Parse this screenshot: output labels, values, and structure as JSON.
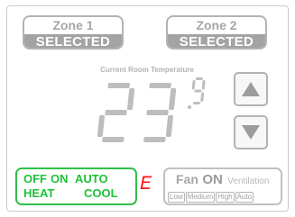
{
  "zones": [
    {
      "label": "Zone 1",
      "status": "SELECTED"
    },
    {
      "label": "Zone 2",
      "status": "SELECTED"
    }
  ],
  "temperature": {
    "label": "Current Room Temperature",
    "integer": "23",
    "decimal": "9",
    "display_color": "#bdbdbd"
  },
  "controls": {
    "up_icon": "triangle-up-icon",
    "down_icon": "triangle-down-icon"
  },
  "mode": {
    "off": "OFF",
    "on": "ON",
    "auto": "AUTO",
    "heat": "HEAT",
    "cool": "COOL",
    "accent_color": "#1ec239"
  },
  "error_indicator": {
    "text": "E",
    "color": "#ff1a1a"
  },
  "fan": {
    "title_fan": "Fan",
    "title_on": "ON",
    "ventilation": "Ventilation",
    "options": [
      "Low",
      "Medium",
      "High",
      "Auto"
    ]
  }
}
